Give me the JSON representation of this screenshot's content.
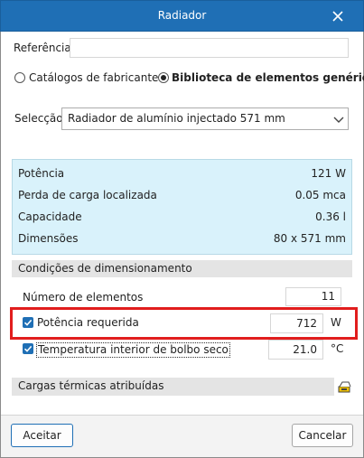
{
  "window": {
    "title": "Radiador"
  },
  "reference": {
    "label": "Referência",
    "value": ""
  },
  "source": {
    "options": [
      {
        "label": "Catálogos de fabricante",
        "selected": false
      },
      {
        "label": "Biblioteca de elementos genéricos",
        "selected": true
      }
    ]
  },
  "selection": {
    "label": "Selecção",
    "value": "Radiador de alumínio injectado 571 mm"
  },
  "properties": [
    {
      "label": "Potência",
      "value": "121 W"
    },
    {
      "label": "Perda de carga localizada",
      "value": "0.05 mca"
    },
    {
      "label": "Capacidade",
      "value": "0.36 l"
    },
    {
      "label": "Dimensões",
      "value": "80 x 571 mm"
    }
  ],
  "sizing": {
    "header": "Condições de dimensionamento",
    "elements": {
      "label": "Número de elementos",
      "value": "11"
    },
    "power": {
      "label": "Potência requerida",
      "value": "712",
      "unit": "W",
      "checked": true
    },
    "temperature": {
      "label": "Temperatura interior de bolbo seco",
      "value": "21.0",
      "unit": "°C",
      "checked": true
    }
  },
  "loads": {
    "header": "Cargas térmicas atribuídas"
  },
  "footer": {
    "accept": "Aceitar",
    "cancel": "Cancelar"
  },
  "colors": {
    "titlebar": "#1f6fb5",
    "infobox": "#d9f2fb",
    "highlight": "#e11d1d"
  }
}
